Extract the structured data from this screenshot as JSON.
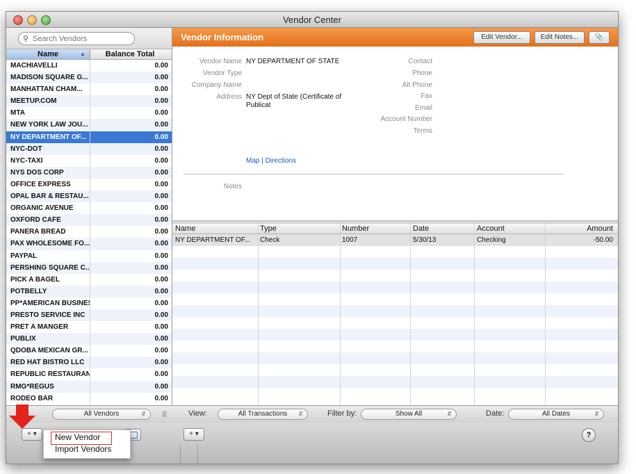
{
  "window": {
    "title": "Vendor Center"
  },
  "search": {
    "placeholder": "Search Vendors"
  },
  "vendor_list": {
    "columns": {
      "name": "Name",
      "balance": "Balance Total"
    },
    "rows": [
      {
        "name": "MACHIAVELLI",
        "balance": "0.00"
      },
      {
        "name": "MADISON SQUARE G...",
        "balance": "0.00"
      },
      {
        "name": "MANHATTAN CHAM...",
        "balance": "0.00"
      },
      {
        "name": "MEETUP.COM",
        "balance": "0.00"
      },
      {
        "name": "MTA",
        "balance": "0.00"
      },
      {
        "name": "NEW YORK LAW JOU...",
        "balance": "0.00"
      },
      {
        "name": "NY DEPARTMENT OF...",
        "balance": "0.00",
        "selected": true
      },
      {
        "name": "NYC-DOT",
        "balance": "0.00"
      },
      {
        "name": "NYC-TAXI",
        "balance": "0.00"
      },
      {
        "name": "NYS DOS CORP",
        "balance": "0.00"
      },
      {
        "name": "OFFICE EXPRESS",
        "balance": "0.00"
      },
      {
        "name": "OPAL BAR & RESTAU...",
        "balance": "0.00"
      },
      {
        "name": "ORGANIC AVENUE",
        "balance": "0.00"
      },
      {
        "name": "OXFORD CAFE",
        "balance": "0.00"
      },
      {
        "name": "PANERA BREAD",
        "balance": "0.00"
      },
      {
        "name": "PAX WHOLESOME FO...",
        "balance": "0.00"
      },
      {
        "name": "PAYPAL",
        "balance": "0.00"
      },
      {
        "name": "PERSHING SQUARE C...",
        "balance": "0.00"
      },
      {
        "name": "PICK A BAGEL",
        "balance": "0.00"
      },
      {
        "name": "POTBELLY",
        "balance": "0.00"
      },
      {
        "name": "PP*AMERICAN BUSINESS",
        "balance": "0.00"
      },
      {
        "name": "PRESTO SERVICE INC",
        "balance": "0.00"
      },
      {
        "name": "PRET A MANGER",
        "balance": "0.00"
      },
      {
        "name": "PUBLIX",
        "balance": "0.00"
      },
      {
        "name": "QDOBA MEXICAN GR...",
        "balance": "0.00"
      },
      {
        "name": "RED HAT BISTRO LLC",
        "balance": "0.00"
      },
      {
        "name": "REPUBLIC RESTAURANT",
        "balance": "0.00"
      },
      {
        "name": "RMG*REGUS",
        "balance": "0.00"
      },
      {
        "name": "RODEO BAR",
        "balance": "0.00"
      }
    ]
  },
  "vendor_info": {
    "title": "Vendor Information",
    "buttons": {
      "edit_vendor": "Edit Vendor...",
      "edit_notes": "Edit Notes..."
    },
    "labels": {
      "vendor_name": "Vendor Name",
      "vendor_type": "Vendor Type",
      "company_name": "Company Name",
      "address": "Address",
      "contact": "Contact",
      "phone": "Phone",
      "alt_phone": "Alt Phone",
      "fax": "Fax",
      "email": "Email",
      "account_number": "Account Number",
      "terms": "Terms",
      "notes": "Notes"
    },
    "values": {
      "vendor_name": "NY DEPARTMENT OF STATE",
      "address_line1": "NY Dept of State (Certificate of",
      "address_line2": "Publicat"
    },
    "links": {
      "map": "Map",
      "separator": "|",
      "directions": "Directions"
    }
  },
  "transactions": {
    "columns": {
      "name": "Name",
      "type": "Type",
      "number": "Number",
      "date": "Date",
      "account": "Account",
      "amount": "Amount"
    },
    "rows": [
      {
        "name": "NY DEPARTMENT OF...",
        "type": "Check",
        "number": "1007",
        "date": "5/30/13",
        "account": "Checking",
        "amount": "-50.00"
      }
    ]
  },
  "filters": {
    "vendor_filter": "All Vendors",
    "view_label": "View:",
    "view_value": "All Transactions",
    "filter_label": "Filter by:",
    "filter_value": "Show All",
    "date_label": "Date:",
    "date_value": "All Dates"
  },
  "toolbar": {
    "add_glyph": "+ ▾",
    "help_glyph": "?"
  },
  "popup_menu": {
    "items": [
      "New Vendor",
      "Import Vendors"
    ]
  },
  "colors": {
    "accent_orange": "#e97a22",
    "selection_blue": "#3a78d4",
    "arrow_red": "#e3241b",
    "link_blue": "#1a56c4"
  }
}
